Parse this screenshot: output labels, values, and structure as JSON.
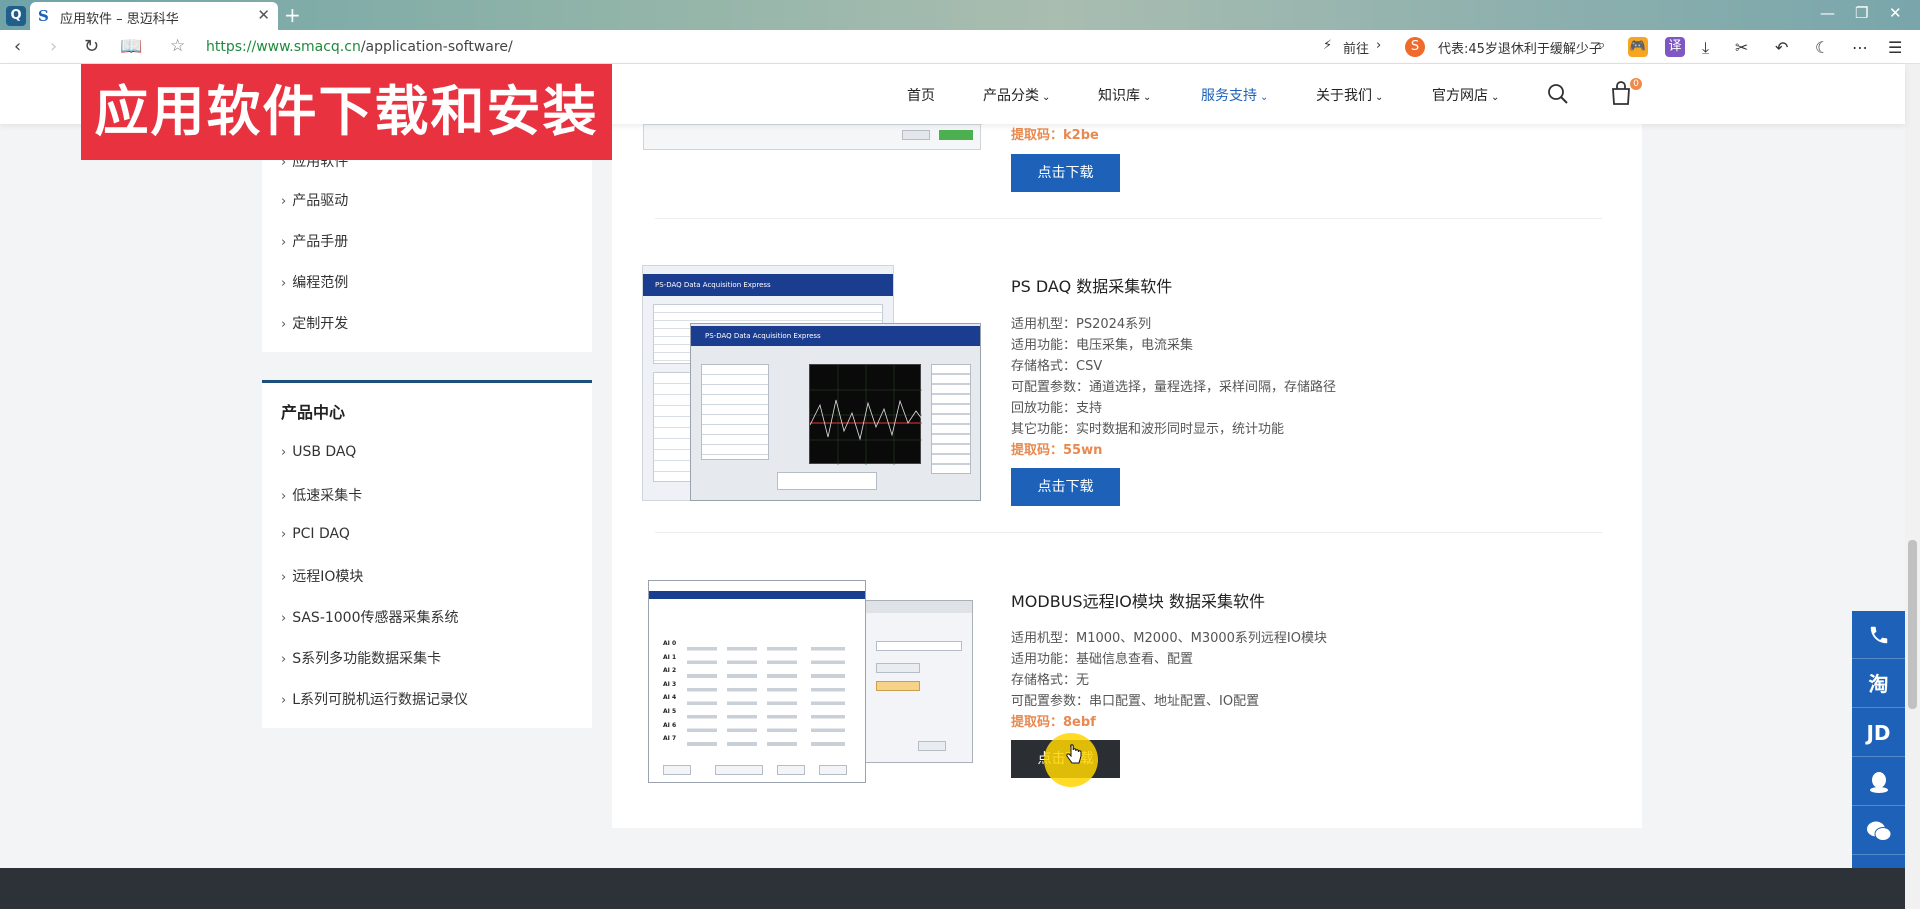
{
  "browser": {
    "tab_title": "应用软件 – 思迈科华",
    "url_protocol": "https://",
    "url_host": "www.smacq.cn",
    "url_path": "/application-software/",
    "forward_label": "前往",
    "news_text": "代表:45岁退休利于缓解少子"
  },
  "banner": {
    "text": "应用软件下载和安装"
  },
  "nav": {
    "items": [
      "首页",
      "产品分类",
      "知识库",
      "服务支持",
      "关于我们",
      "官方网店"
    ],
    "cart_count": "0"
  },
  "sidebar": {
    "support_links": [
      "应用软件",
      "产品驱动",
      "产品手册",
      "编程范例",
      "定制开发"
    ],
    "product_heading": "产品中心",
    "product_links": [
      "USB DAQ",
      "低速采集卡",
      "PCI DAQ",
      "远程IO模块",
      "SAS-1000传感器采集系统",
      "S系列多功能数据采集卡",
      "L系列可脱机运行数据记录仪"
    ]
  },
  "products": [
    {
      "code_label": "提取码：",
      "code": "k2be",
      "button": "点击下载"
    },
    {
      "title": "PS DAQ 数据采集软件",
      "specs": [
        "适用机型：PS2024系列",
        "适用功能：电压采集，电流采集",
        "存储格式：CSV",
        "可配置参数：通道选择，量程选择，采样间隔，存储路径",
        "回放功能：支持",
        "其它功能：实时数据和波形同时显示，统计功能"
      ],
      "code_label": "提取码：",
      "code": "55wn",
      "button": "点击下载",
      "screenshot_title": "PS-DAQ  Data Acquisition Express"
    },
    {
      "title": "MODBUS远程IO模块 数据采集软件",
      "specs": [
        "适用机型：M1000、M2000、M3000系列远程IO模块",
        "适用功能：基础信息查看、配置",
        "存储格式：无",
        "可配置参数：串口配置、地址配置、IO配置"
      ],
      "code_label": "提取码：",
      "code": "8ebf",
      "button": "点击下载",
      "screenshot_rows": [
        "AI 0",
        "AI 1",
        "AI 2",
        "AI 3",
        "AI 4",
        "AI 5",
        "AI 6",
        "AI 7"
      ]
    }
  ],
  "float_bar": [
    "phone-icon",
    "淘",
    "JD",
    "qq-icon",
    "wechat-icon",
    "mail-icon"
  ],
  "colors": {
    "brand_blue": "#1d62b8",
    "banner_red": "#e8323f",
    "code_orange": "#e8894f"
  }
}
